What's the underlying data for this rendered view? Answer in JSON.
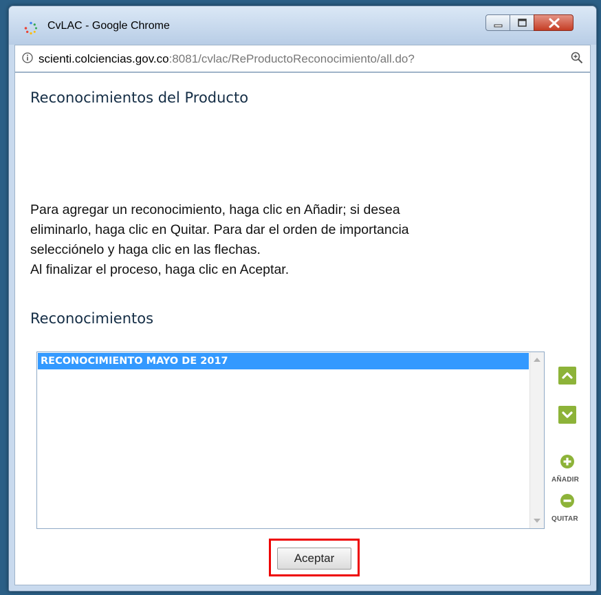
{
  "window": {
    "title": "CvLAC - Google Chrome",
    "controls": {
      "minimize_icon": "minimize-icon",
      "maximize_icon": "maximize-icon",
      "close_icon": "close-icon"
    }
  },
  "address_bar": {
    "url_host": "scienti.colciencias.gov.co",
    "url_rest": ":8081/cvlac/ReProductoReconocimiento/all.do?",
    "info_icon": "info-icon",
    "zoom_icon": "zoom-icon"
  },
  "page": {
    "title": "Reconocimientos del Producto",
    "instructions": [
      "Para agregar un reconocimiento, haga clic en Añadir; si desea",
      "eliminarlo, haga clic en Quitar. Para dar el orden de importancia",
      "selecciónelo y haga clic en las flechas.",
      "Al finalizar el proceso, haga clic en Aceptar."
    ],
    "section_title": "Reconocimientos",
    "list_items": [
      "RECONOCIMIENTO MAYO DE 2017"
    ],
    "side_controls": {
      "move_up_icon": "chevron-up-icon",
      "move_down_icon": "chevron-down-icon",
      "add_label": "AÑADIR",
      "remove_label": "QUITAR"
    },
    "accept_button": "Aceptar",
    "colors": {
      "accent_green": "#8db339",
      "selection_blue": "#3399ff",
      "highlight_red": "#ee0000"
    }
  }
}
